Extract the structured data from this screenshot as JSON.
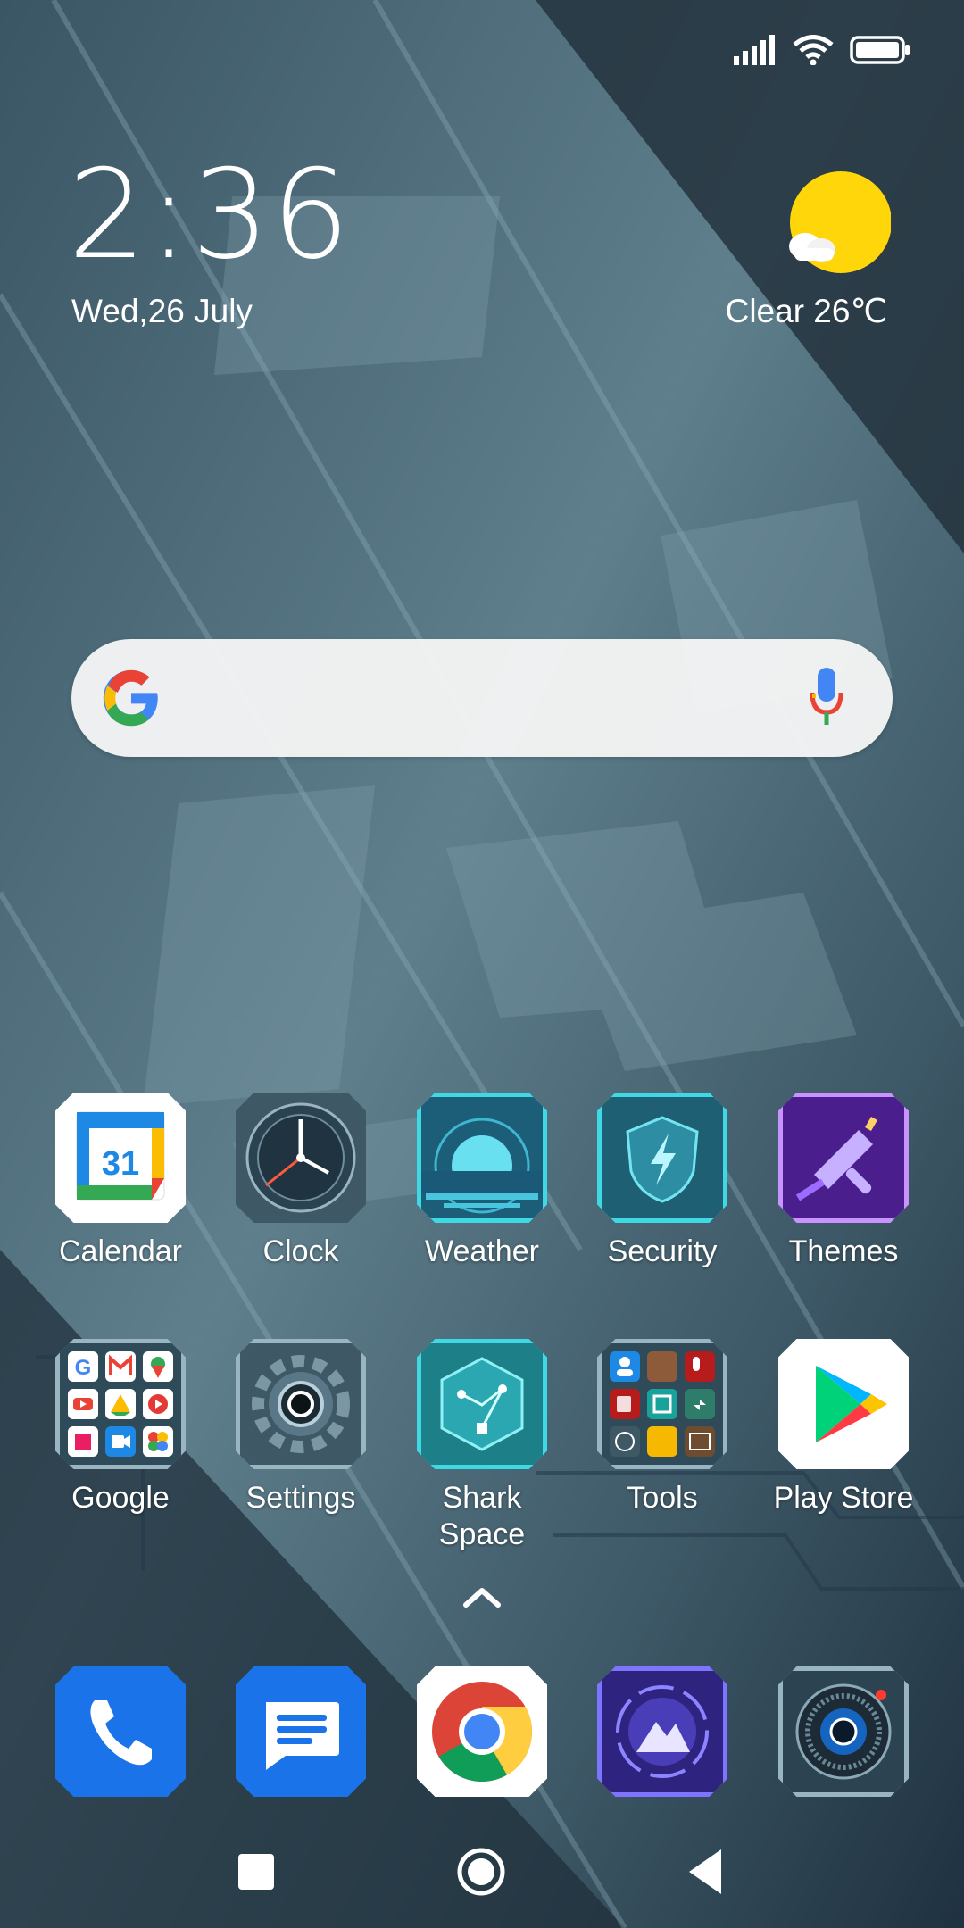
{
  "status_bar": {
    "signal_icon": "cellular-signal-icon",
    "wifi_icon": "wifi-icon",
    "battery_icon": "battery-icon"
  },
  "clock_widget": {
    "time": "2:36",
    "date": "Wed,26 July"
  },
  "weather_widget": {
    "icon": "sun-cloud-icon",
    "text": "Clear 26℃"
  },
  "search_bar": {
    "logo": "google-logo-icon",
    "mic": "microphone-icon"
  },
  "apps": {
    "row1": [
      {
        "label": "Calendar"
      },
      {
        "label": "Clock"
      },
      {
        "label": "Weather"
      },
      {
        "label": "Security"
      },
      {
        "label": "Themes"
      }
    ],
    "row2": [
      {
        "label": "Google"
      },
      {
        "label": "Settings"
      },
      {
        "label": "Shark\nSpace"
      },
      {
        "label": "Tools"
      },
      {
        "label": "Play Store"
      }
    ]
  },
  "dock": [
    {
      "icon": "phone-icon"
    },
    {
      "icon": "messages-icon"
    },
    {
      "icon": "chrome-icon"
    },
    {
      "icon": "gallery-icon"
    },
    {
      "icon": "camera-icon"
    }
  ],
  "nav_bar": {
    "recent": "recent-apps-icon",
    "home": "home-icon",
    "back": "back-icon"
  },
  "colors": {
    "wallpaper": "#35505f",
    "accent_cyan": "#3fd9e6",
    "sun": "#ffd60a"
  }
}
